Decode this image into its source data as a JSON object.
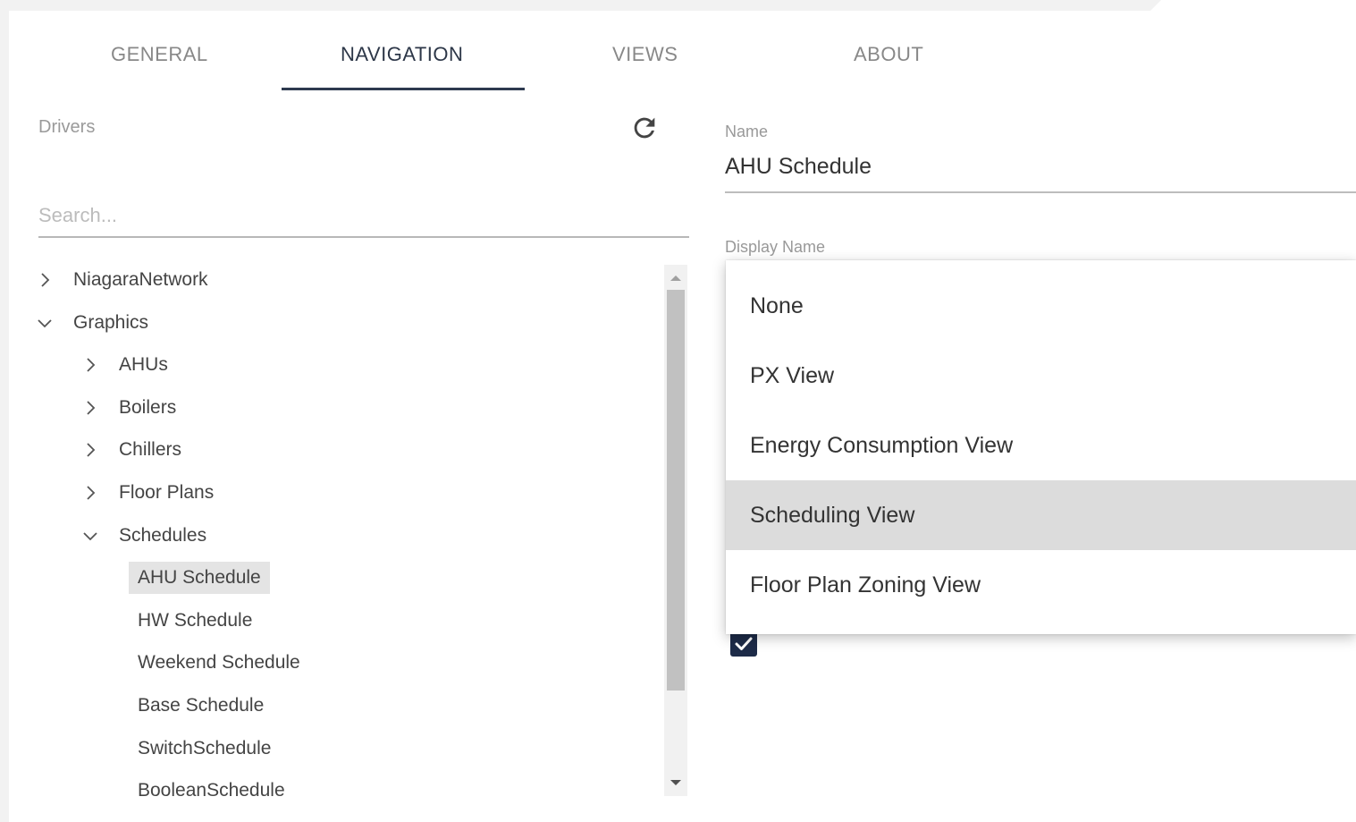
{
  "tabs": [
    {
      "label": "GENERAL"
    },
    {
      "label": "NAVIGATION"
    },
    {
      "label": "VIEWS"
    },
    {
      "label": "ABOUT"
    }
  ],
  "active_tab": "NAVIGATION",
  "drivers": {
    "label": "Drivers",
    "refresh_icon": "refresh-icon",
    "search_placeholder": "Search..."
  },
  "tree": [
    {
      "label": "NiagaraNetwork",
      "level": 0,
      "state": "collapsed"
    },
    {
      "label": "Graphics",
      "level": 0,
      "state": "expanded"
    },
    {
      "label": "AHUs",
      "level": 1,
      "state": "collapsed"
    },
    {
      "label": "Boilers",
      "level": 1,
      "state": "collapsed"
    },
    {
      "label": "Chillers",
      "level": 1,
      "state": "collapsed"
    },
    {
      "label": "Floor Plans",
      "level": 1,
      "state": "collapsed"
    },
    {
      "label": "Schedules",
      "level": 1,
      "state": "expanded"
    },
    {
      "label": "AHU Schedule",
      "level": 2,
      "state": "leaf",
      "selected": true
    },
    {
      "label": "HW Schedule",
      "level": 2,
      "state": "leaf"
    },
    {
      "label": "Weekend Schedule",
      "level": 2,
      "state": "leaf"
    },
    {
      "label": "Base Schedule",
      "level": 2,
      "state": "leaf"
    },
    {
      "label": "SwitchSchedule",
      "level": 2,
      "state": "leaf"
    },
    {
      "label": "BooleanSchedule",
      "level": 2,
      "state": "leaf"
    }
  ],
  "form": {
    "name_label": "Name",
    "name_value": "AHU Schedule",
    "display_name_label": "Display Name",
    "checkbox_checked": true
  },
  "dropdown": {
    "options": [
      "None",
      "PX View",
      "Energy Consumption View",
      "Scheduling View",
      "Floor Plan Zoning View"
    ],
    "highlighted": "Scheduling View"
  },
  "colors": {
    "accent": "#2e3a4f",
    "checkbox": "#1d2b48",
    "highlight": "#dcdcdc"
  }
}
